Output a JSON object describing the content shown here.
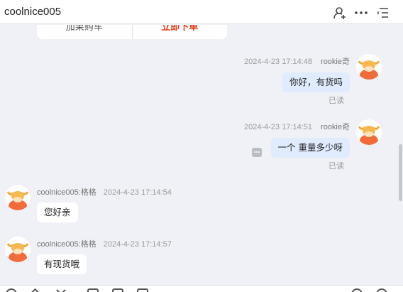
{
  "header": {
    "title": "coolnice005"
  },
  "product_card": {
    "add_to_cart": "加果购车",
    "buy_now": "立即下单"
  },
  "messages": [
    {
      "side": "self",
      "sender": "rookie奇",
      "time": "2024-4-23 17:14:48",
      "text": "你好，有货吗",
      "read": "已读"
    },
    {
      "side": "self",
      "sender": "rookie奇",
      "time": "2024-4-23 17:14:51",
      "text": "一个 重量多少呀",
      "read": "已读"
    },
    {
      "side": "other",
      "sender": "coolnice005:格格",
      "time": "2024-4-23 17:14:54",
      "text": "您好亲"
    },
    {
      "side": "other",
      "sender": "coolnice005:格格",
      "time": "2024-4-23 17:14:57",
      "text": "有现货哦"
    }
  ],
  "colors": {
    "self_bubble": "#e0ebff",
    "other_bubble": "#ffffff",
    "buy_now": "#e83a17",
    "background": "#eff1f6"
  },
  "icons": {
    "header": [
      "add-contact-icon",
      "more-options-icon",
      "menu-list-icon"
    ],
    "toolbar": [
      "emoji-icon",
      "image-icon",
      "scissors-icon",
      "folder-icon",
      "file-icon",
      "history-icon",
      "settings-icon"
    ]
  }
}
